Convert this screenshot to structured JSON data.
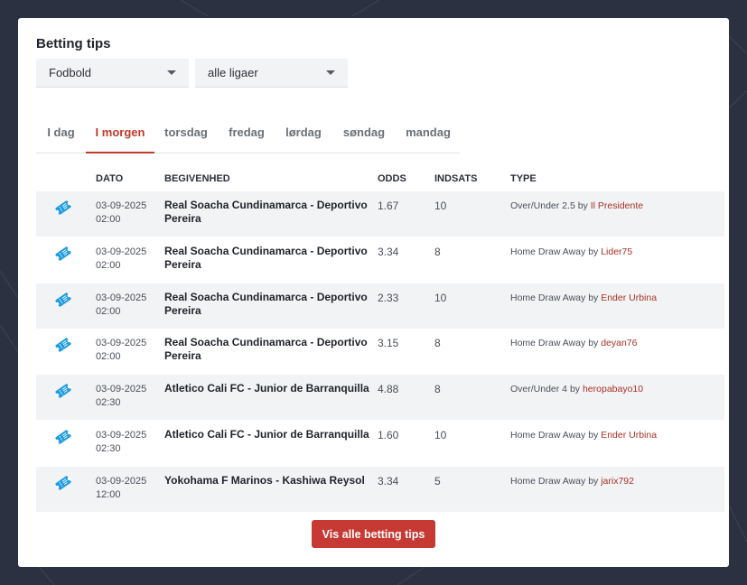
{
  "page": {
    "title": "Betting tips"
  },
  "filters": {
    "sport": "Fodbold",
    "league": "alle ligaer"
  },
  "tabs": [
    {
      "label": "I dag"
    },
    {
      "label": "I morgen"
    },
    {
      "label": "torsdag"
    },
    {
      "label": "fredag"
    },
    {
      "label": "lørdag"
    },
    {
      "label": "søndag"
    },
    {
      "label": "mandag"
    }
  ],
  "active_tab": "I morgen",
  "table": {
    "headers": {
      "date": "DATO",
      "event": "BEGIVENHED",
      "odds": "ODDS",
      "stake": "INDSATS",
      "type": "TYPE"
    },
    "rows": [
      {
        "date": "03-09-2025",
        "time": "02:00",
        "event": "Real Soacha Cundinamarca - Deportivo Pereira",
        "odds": "1.67",
        "stake": "10",
        "type": "Over/Under 2.5",
        "by": "by",
        "user": "Il Presidente"
      },
      {
        "date": "03-09-2025",
        "time": "02:00",
        "event": "Real Soacha Cundinamarca - Deportivo Pereira",
        "odds": "3.34",
        "stake": "8",
        "type": "Home Draw Away",
        "by": "by",
        "user": "Lider75"
      },
      {
        "date": "03-09-2025",
        "time": "02:00",
        "event": "Real Soacha Cundinamarca - Deportivo Pereira",
        "odds": "2.33",
        "stake": "10",
        "type": "Home Draw Away",
        "by": "by",
        "user": "Ender Urbina"
      },
      {
        "date": "03-09-2025",
        "time": "02:00",
        "event": "Real Soacha Cundinamarca - Deportivo Pereira",
        "odds": "3.15",
        "stake": "8",
        "type": "Home Draw Away",
        "by": "by",
        "user": "deyan76"
      },
      {
        "date": "03-09-2025",
        "time": "02:30",
        "event": "Atletico Cali FC - Junior de Barranquilla",
        "odds": "4.88",
        "stake": "8",
        "type": "Over/Under 4",
        "by": "by",
        "user": "heropabayo10"
      },
      {
        "date": "03-09-2025",
        "time": "02:30",
        "event": "Atletico Cali FC - Junior de Barranquilla",
        "odds": "1.60",
        "stake": "10",
        "type": "Home Draw Away",
        "by": "by",
        "user": "Ender Urbina"
      },
      {
        "date": "03-09-2025",
        "time": "12:00",
        "event": "Yokohama F Marinos - Kashiwa Reysol",
        "odds": "3.34",
        "stake": "5",
        "type": "Home Draw Away",
        "by": "by",
        "user": "jarix792"
      }
    ]
  },
  "cta": {
    "label": "Vis alle betting tips"
  },
  "colors": {
    "accent": "#c0392b",
    "ticket": "#1e9be0",
    "background": "#2b3140"
  },
  "icons": {
    "row": "ticket-icon",
    "select": "caret-down-icon"
  }
}
